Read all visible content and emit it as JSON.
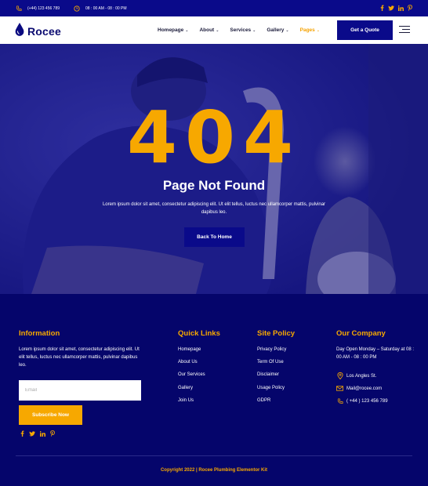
{
  "topbar": {
    "phone": "(+44) 123 456 789",
    "hours": "08 : 00 AM - 08 : 00 PM",
    "social_icons": [
      "facebook-icon",
      "twitter-icon",
      "linkedin-icon",
      "pinterest-icon"
    ]
  },
  "header": {
    "logo_text": "Rocee",
    "nav": [
      {
        "label": "Homepage",
        "active": false
      },
      {
        "label": "About",
        "active": false
      },
      {
        "label": "Services",
        "active": false
      },
      {
        "label": "Gallery",
        "active": false
      },
      {
        "label": "Pages",
        "active": true
      }
    ],
    "cta_label": "Get a Quote"
  },
  "hero": {
    "code": "404",
    "title": "Page Not Found",
    "description": "Lorem ipsum dolor sit amet, consectetur adipiscing elit. Ut elit tellus, luctus nec ullamcorper mattis, pulvinar dapibus leo.",
    "button_label": "Back To Home"
  },
  "footer": {
    "information": {
      "title": "Information",
      "description": "Lorem ipsum dolor sit amet, consectetur adipiscing elit. Ut elit tellus, luctus nec ullamcorper mattis, pulvinar dapibus leo.",
      "email_placeholder": "Email",
      "subscribe_label": "Subscribe Now"
    },
    "quick_links": {
      "title": "Quick Links",
      "items": [
        "Homepage",
        "About Us",
        "Our Services",
        "Gallery",
        "Join Us"
      ]
    },
    "site_policy": {
      "title": "Site Policy",
      "items": [
        "Privacy Policy",
        "Term Of Use",
        "Disclaimer",
        "Usage Policy",
        "GDPR"
      ]
    },
    "company": {
      "title": "Our Company",
      "hours": "Day Open Monday – Saturday at 08 : 00 AM - 08 : 00 PM",
      "location": "Los Angles St.",
      "email": "Mail@rocee.com",
      "phone": "( +44 ) 123 456 789"
    },
    "copyright": "Copyright 2022 | Rocee Plumbing Elementor Kit"
  },
  "colors": {
    "primary": "#0a0a8a",
    "accent": "#f7a800",
    "footer_bg": "#05056b"
  }
}
